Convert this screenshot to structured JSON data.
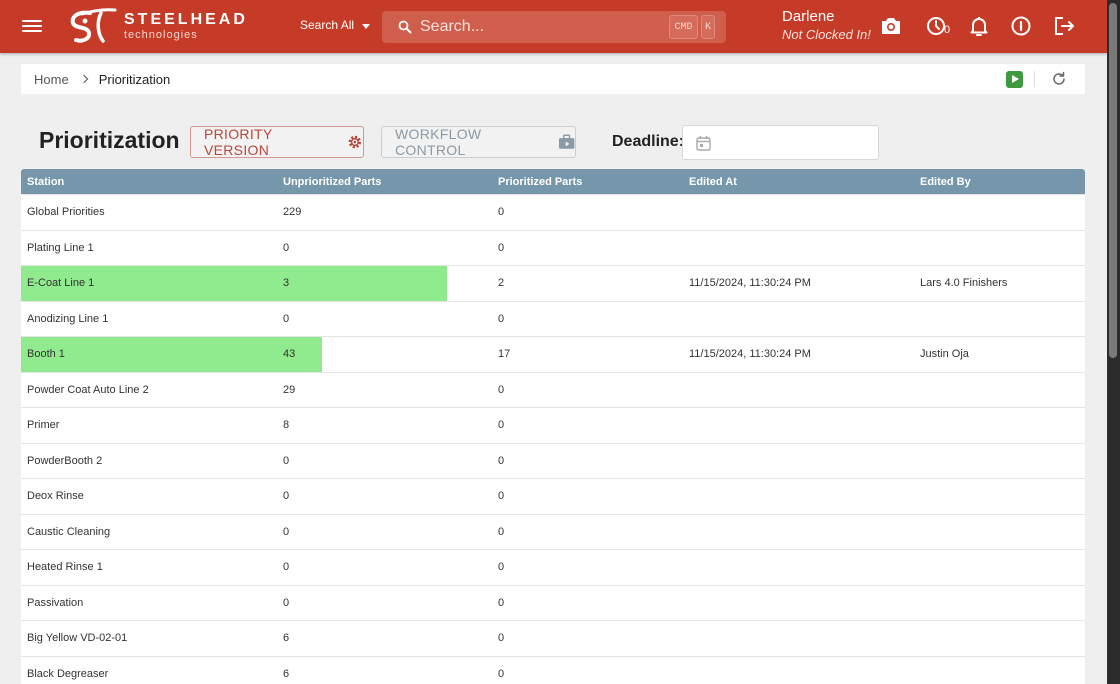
{
  "header": {
    "brand_name": "STEELHEAD",
    "brand_sub": "technologies",
    "search_scope": "Search All",
    "search_placeholder": "Search...",
    "shortcut_keys": [
      "CMD",
      "K"
    ],
    "user_name": "Darlene",
    "user_status": "Not Clocked In!",
    "clock_count": "0",
    "brand_color": "#c63b27"
  },
  "breadcrumb": {
    "home": "Home",
    "current": "Prioritization"
  },
  "page": {
    "title": "Prioritization",
    "priority_version_label": "PRIORITY VERSION",
    "workflow_control_label": "WORKFLOW CONTROL",
    "deadline_label": "Deadline:",
    "deadline_value": ""
  },
  "table": {
    "columns": [
      "Station",
      "Unprioritized Parts",
      "Prioritized Parts",
      "Edited At",
      "Edited By"
    ],
    "progress_color": "#90ea8e",
    "rows": [
      {
        "station": "Global Priorities",
        "unprioritized": "229",
        "prioritized": "0",
        "edited_at": "",
        "edited_by": "",
        "progress": 0
      },
      {
        "station": "Plating Line 1",
        "unprioritized": "0",
        "prioritized": "0",
        "edited_at": "",
        "edited_by": "",
        "progress": 0
      },
      {
        "station": "E-Coat Line 1",
        "unprioritized": "3",
        "prioritized": "2",
        "edited_at": "11/15/2024, 11:30:24 PM",
        "edited_by": "Lars 4.0 Finishers",
        "progress": 0.4
      },
      {
        "station": "Anodizing Line 1",
        "unprioritized": "0",
        "prioritized": "0",
        "edited_at": "",
        "edited_by": "",
        "progress": 0
      },
      {
        "station": "Booth 1",
        "unprioritized": "43",
        "prioritized": "17",
        "edited_at": "11/15/2024, 11:30:24 PM",
        "edited_by": "Justin Oja",
        "progress": 0.2833
      },
      {
        "station": "Powder Coat Auto Line 2",
        "unprioritized": "29",
        "prioritized": "0",
        "edited_at": "",
        "edited_by": "",
        "progress": 0
      },
      {
        "station": "Primer",
        "unprioritized": "8",
        "prioritized": "0",
        "edited_at": "",
        "edited_by": "",
        "progress": 0
      },
      {
        "station": "PowderBooth 2",
        "unprioritized": "0",
        "prioritized": "0",
        "edited_at": "",
        "edited_by": "",
        "progress": 0
      },
      {
        "station": "Deox Rinse",
        "unprioritized": "0",
        "prioritized": "0",
        "edited_at": "",
        "edited_by": "",
        "progress": 0
      },
      {
        "station": "Caustic Cleaning",
        "unprioritized": "0",
        "prioritized": "0",
        "edited_at": "",
        "edited_by": "",
        "progress": 0
      },
      {
        "station": "Heated Rinse 1",
        "unprioritized": "0",
        "prioritized": "0",
        "edited_at": "",
        "edited_by": "",
        "progress": 0
      },
      {
        "station": "Passivation",
        "unprioritized": "0",
        "prioritized": "0",
        "edited_at": "",
        "edited_by": "",
        "progress": 0
      },
      {
        "station": "Big Yellow VD-02-01",
        "unprioritized": "6",
        "prioritized": "0",
        "edited_at": "",
        "edited_by": "",
        "progress": 0
      },
      {
        "station": "Black Degreaser",
        "unprioritized": "6",
        "prioritized": "0",
        "edited_at": "",
        "edited_by": "",
        "progress": 0
      }
    ]
  }
}
